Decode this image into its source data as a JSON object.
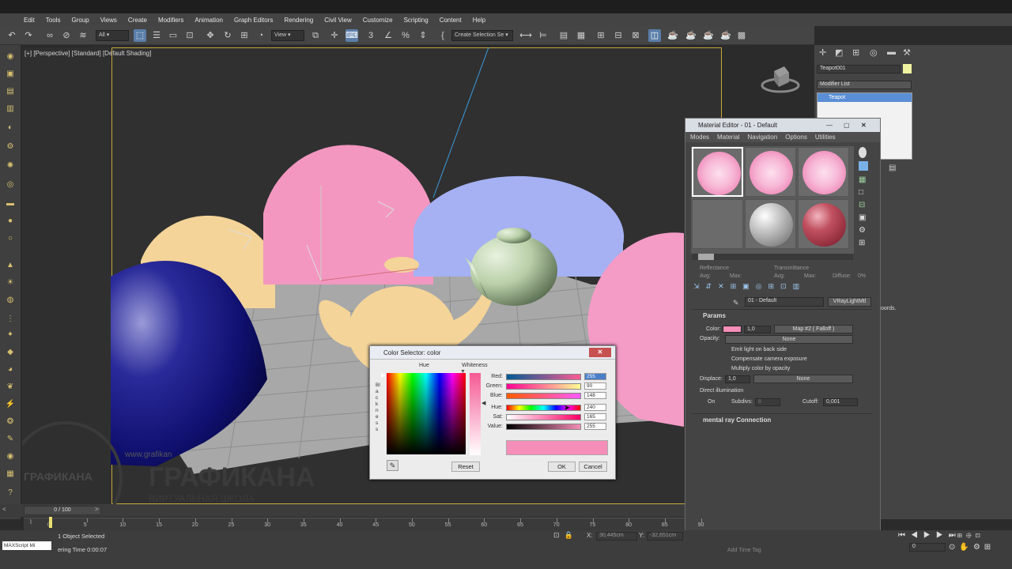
{
  "menu": [
    "Edit",
    "Tools",
    "Group",
    "Views",
    "Create",
    "Modifiers",
    "Animation",
    "Graph Editors",
    "Rendering",
    "Civil View",
    "Customize",
    "Scripting",
    "Content",
    "Help"
  ],
  "toolbar": {
    "filter": "All",
    "coord": "View",
    "selection_set": "Create Selection Se"
  },
  "viewport": {
    "label": "[+] [Perspective] [Standard] [Default Shading]"
  },
  "command_panel": {
    "object_name": "Teapot001",
    "modifier_list": "Modifier List",
    "stack_item": "Teapot",
    "side_text": "oords."
  },
  "material_editor": {
    "title": "Material Editor - 01 - Default",
    "menu": [
      "Modes",
      "Material",
      "Navigation",
      "Options",
      "Utilities"
    ],
    "reflectance": "Reflectance",
    "transmittance": "Transmittance",
    "avg": "Avg:",
    "max": "Max:",
    "diffuse": "Diffuse:",
    "diffuse_val": "0%",
    "material_name": "01 - Default",
    "material_type": "VRayLightMtl",
    "params": "Params",
    "color_label": "Color:",
    "color_mult": "1,0",
    "color_map": "Map #2  ( Falloff )",
    "opacity_label": "Opacity:",
    "opacity_map": "None",
    "emit_back": "Emit light on back side",
    "comp_exposure": "Compensate camera exposure",
    "mult_opacity": "Multiply color by opacity",
    "displace_label": "Displace:",
    "displace_val": "1,0",
    "displace_map": "None",
    "direct_illum": "Direct illumination",
    "on_label": "On",
    "subdivs_label": "Subdivs:",
    "subdivs_val": "8",
    "cutoff_label": "Cutoff:",
    "cutoff_val": "0,001",
    "mental_ray": "mental ray Connection"
  },
  "color_selector": {
    "title": "Color Selector: color",
    "hue_label": "Hue",
    "whiteness_label": "Whiteness",
    "blackness_label": "Blackness",
    "red_label": "Red:",
    "red": "255",
    "green_label": "Green:",
    "green": "90",
    "blue_label": "Blue:",
    "blue": "148",
    "hue2_label": "Hue:",
    "hue": "240",
    "sat_label": "Sat:",
    "sat": "165",
    "value_label": "Value:",
    "value": "255",
    "swatch_color": "#f58eb8",
    "reset": "Reset",
    "ok": "OK",
    "cancel": "Cancel"
  },
  "timeline": {
    "frame": "0 / 100",
    "ticks": [
      "0",
      "5",
      "10",
      "15",
      "20",
      "25",
      "30",
      "35",
      "40",
      "45",
      "50",
      "55",
      "60",
      "65",
      "70",
      "75",
      "80",
      "85",
      "90"
    ]
  },
  "status": {
    "maxscript": "MAXScript Mi",
    "selected": "1 Object Selected",
    "render_time": "ering Time  0:00:07",
    "x": "30,445cm",
    "y": "-32,651cm",
    "add_time_tag": "Add Time Tag",
    "frame_field": "0"
  },
  "watermark": {
    "logo": "ГРАФИКАНА",
    "big": "ГРАФИКАНА",
    "sub": "ВИРТУАЛЬНАЯ ШКОЛА",
    "url": "www.grafikan"
  }
}
